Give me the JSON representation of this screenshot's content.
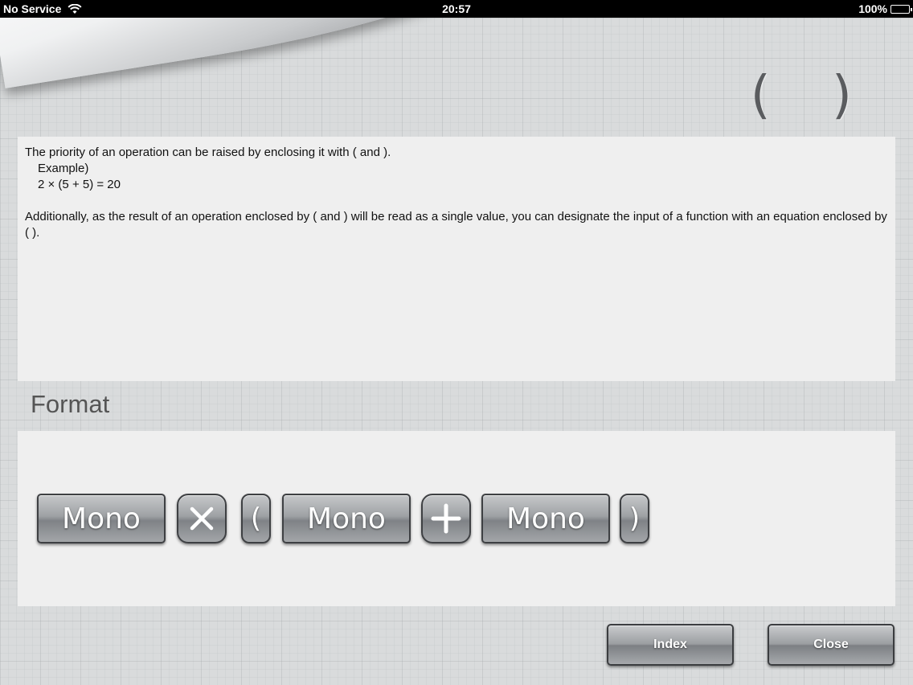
{
  "status_bar": {
    "carrier": "No Service",
    "time": "20:57",
    "battery": "100%",
    "battery_level": 1.0
  },
  "page": {
    "title": "( )"
  },
  "description": {
    "line1": "The priority of an operation can be raised by enclosing it with ( and ).",
    "example_label": "Example)",
    "example_expr": "2 × (5 + 5) = 20",
    "line2": "Additionally, as the result of an operation enclosed by ( and ) will be read as a single value, you can designate the input of a function with an equation enclosed by ( )."
  },
  "format": {
    "heading": "Format",
    "keys": [
      {
        "type": "mono",
        "label": "Mono"
      },
      {
        "type": "operator",
        "icon": "multiply-icon"
      },
      {
        "type": "paren",
        "label": "("
      },
      {
        "type": "mono",
        "label": "Mono"
      },
      {
        "type": "operator",
        "icon": "plus-icon"
      },
      {
        "type": "mono",
        "label": "Mono"
      },
      {
        "type": "paren",
        "label": ")"
      }
    ]
  },
  "buttons": {
    "index": "Index",
    "close": "Close"
  },
  "colors": {
    "background": "#d9dbdc",
    "panel": "#efefef",
    "key_border": "#3e4043"
  }
}
